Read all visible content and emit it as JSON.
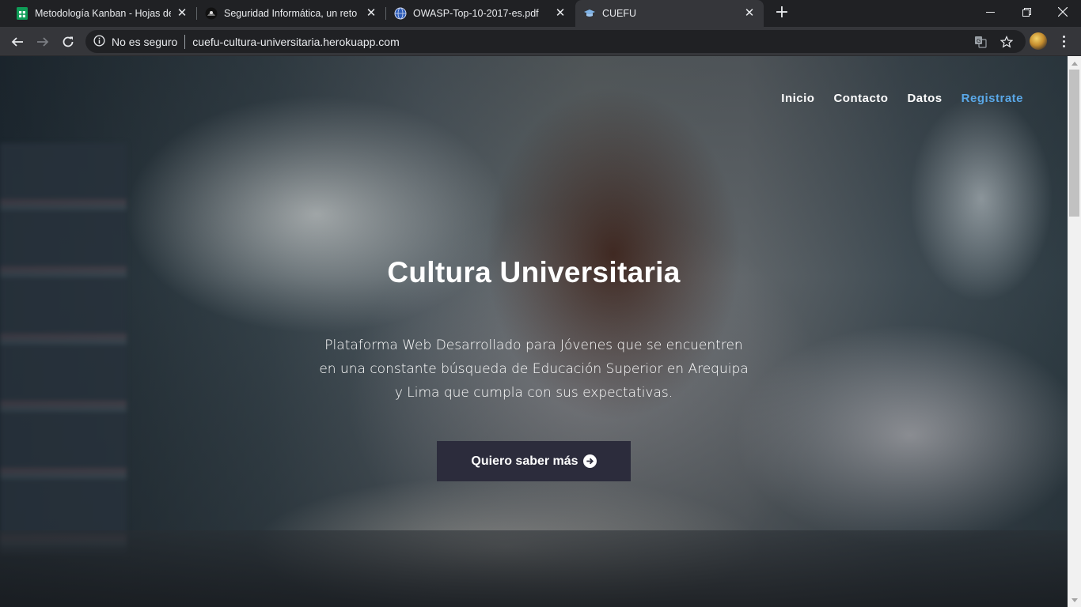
{
  "browser": {
    "tabs": [
      {
        "title": "Metodología Kanban - Hojas de c",
        "favicon": "sheets-icon",
        "active": false
      },
      {
        "title": "Seguridad Informática, un reto pa",
        "favicon": "hacker-icon",
        "active": false
      },
      {
        "title": "OWASP-Top-10-2017-es.pdf",
        "favicon": "globe-icon",
        "active": false
      },
      {
        "title": "CUEFU",
        "favicon": "graduation-cap-icon",
        "active": true
      }
    ],
    "new_tab": "+",
    "address": {
      "security_text": "No es seguro",
      "url": "cuefu-cultura-universitaria.herokuapp.com"
    }
  },
  "site": {
    "nav": {
      "inicio": "Inicio",
      "contacto": "Contacto",
      "datos": "Datos",
      "registrate": "Registrate"
    },
    "hero": {
      "title": "Cultura Universitaria",
      "description": "Plataforma Web Desarrollado para Jóvenes que se encuentren en una constante búsqueda de Educación Superior en Arequipa y Lima que cumpla con sus expectativas.",
      "cta_label": "Quiero saber más"
    }
  },
  "colors": {
    "accent_link": "#5aa8e8",
    "cta_background": "#2c2c3c",
    "chrome_dark": "#202124",
    "chrome_toolbar": "#35363a"
  }
}
